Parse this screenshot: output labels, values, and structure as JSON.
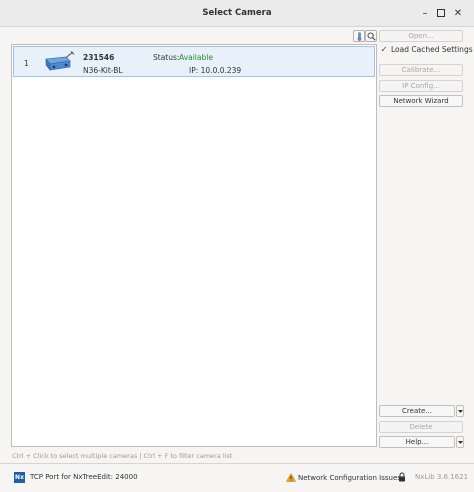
{
  "window": {
    "title": "Select Camera"
  },
  "toolbar": {
    "temp_icon": "thermometer-icon",
    "search_icon": "search-icon"
  },
  "camera_list": {
    "rows": [
      {
        "index": "1",
        "serial": "231546",
        "model": "N36-Kit-BL",
        "status_label": "Status:",
        "status_value": "Available",
        "ip": "IP: 10.0.0.239"
      }
    ]
  },
  "side_panel": {
    "open": "Open...",
    "load_cached": "Load Cached Settings",
    "load_cached_checked": true,
    "calibrate": "Calibrate...",
    "ip_config": "IP Config...",
    "network_wizard": "Network Wizard",
    "create": "Create...",
    "delete": "Delete",
    "help": "Help..."
  },
  "hint": "Ctrl + Click to select multiple cameras | Ctrl + F to filter camera list",
  "status": {
    "tcp_port": "TCP Port for NxTreeEdit:  24000",
    "network_issues": "Network Configuration Issues",
    "version": "NxLib 3.6.1621"
  },
  "colors": {
    "status_available": "#2a8a2a",
    "selection": "#e8f1fa",
    "logo": "#1f5ea8",
    "warning": "#f0a020"
  }
}
